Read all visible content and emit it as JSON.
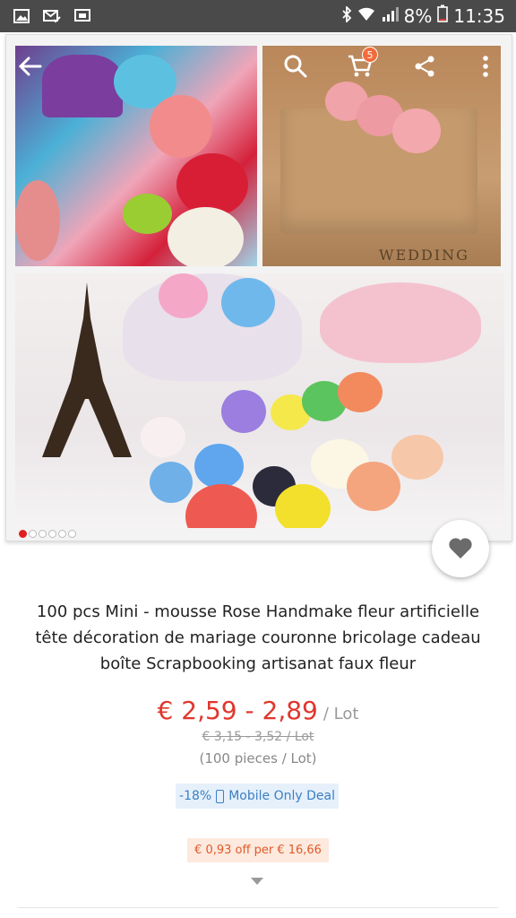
{
  "status_bar": {
    "battery": "8%",
    "time": "11:35",
    "icons": [
      "gallery-icon",
      "email-check-icon",
      "screenshot-icon",
      "bluetooth-icon",
      "wifi-icon",
      "signal-icon",
      "battery-icon"
    ]
  },
  "header": {
    "back_icon": "arrow-left-icon",
    "search_icon": "search-icon",
    "cart_icon": "cart-icon",
    "cart_count": "5",
    "share_icon": "share-icon",
    "more_icon": "more-vertical-icon"
  },
  "gallery": {
    "image_count": 6,
    "active_index": 0,
    "watermark": "WEDDING"
  },
  "product": {
    "title_lines": [
      "100 pcs Mini - mousse Rose Handmake fleur artificielle",
      "tête décoration de mariage couronne bricolage cadeau",
      "boîte Scrapbooking artisanat faux fleur"
    ],
    "price": "€ 2,59 - 2,89",
    "price_unit": "/ Lot",
    "old_price": "€ 3,15 - 3,52 / Lot",
    "pieces": "(100 pieces / Lot)",
    "deal_discount": "-18%",
    "deal_label": "Mobile Only Deal",
    "coupon": "€ 0,93 off per € 16,66"
  },
  "colors": {
    "status_bar": "#4a4a4a",
    "price": "#e0362c",
    "deal_text": "#3b7fc4",
    "deal_bg": "#e6f0fb",
    "coupon_text": "#e05a2a",
    "coupon_bg": "#fde9dd",
    "cart_badge": "#f26b3a",
    "active_dot": "#e02020"
  }
}
